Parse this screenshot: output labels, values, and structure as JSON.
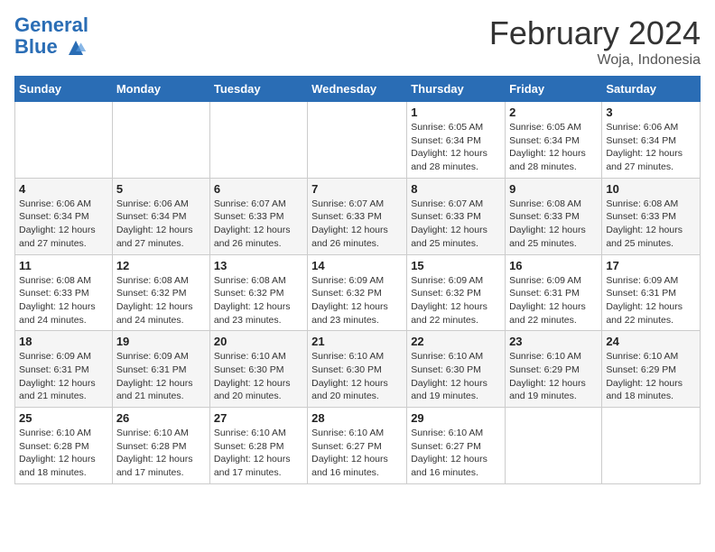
{
  "header": {
    "logo_general": "General",
    "logo_blue": "Blue",
    "month_title": "February 2024",
    "location": "Woja, Indonesia"
  },
  "days_of_week": [
    "Sunday",
    "Monday",
    "Tuesday",
    "Wednesday",
    "Thursday",
    "Friday",
    "Saturday"
  ],
  "weeks": [
    [
      {
        "num": "",
        "info": ""
      },
      {
        "num": "",
        "info": ""
      },
      {
        "num": "",
        "info": ""
      },
      {
        "num": "",
        "info": ""
      },
      {
        "num": "1",
        "info": "Sunrise: 6:05 AM\nSunset: 6:34 PM\nDaylight: 12 hours and 28 minutes."
      },
      {
        "num": "2",
        "info": "Sunrise: 6:05 AM\nSunset: 6:34 PM\nDaylight: 12 hours and 28 minutes."
      },
      {
        "num": "3",
        "info": "Sunrise: 6:06 AM\nSunset: 6:34 PM\nDaylight: 12 hours and 27 minutes."
      }
    ],
    [
      {
        "num": "4",
        "info": "Sunrise: 6:06 AM\nSunset: 6:34 PM\nDaylight: 12 hours and 27 minutes."
      },
      {
        "num": "5",
        "info": "Sunrise: 6:06 AM\nSunset: 6:34 PM\nDaylight: 12 hours and 27 minutes."
      },
      {
        "num": "6",
        "info": "Sunrise: 6:07 AM\nSunset: 6:33 PM\nDaylight: 12 hours and 26 minutes."
      },
      {
        "num": "7",
        "info": "Sunrise: 6:07 AM\nSunset: 6:33 PM\nDaylight: 12 hours and 26 minutes."
      },
      {
        "num": "8",
        "info": "Sunrise: 6:07 AM\nSunset: 6:33 PM\nDaylight: 12 hours and 25 minutes."
      },
      {
        "num": "9",
        "info": "Sunrise: 6:08 AM\nSunset: 6:33 PM\nDaylight: 12 hours and 25 minutes."
      },
      {
        "num": "10",
        "info": "Sunrise: 6:08 AM\nSunset: 6:33 PM\nDaylight: 12 hours and 25 minutes."
      }
    ],
    [
      {
        "num": "11",
        "info": "Sunrise: 6:08 AM\nSunset: 6:33 PM\nDaylight: 12 hours and 24 minutes."
      },
      {
        "num": "12",
        "info": "Sunrise: 6:08 AM\nSunset: 6:32 PM\nDaylight: 12 hours and 24 minutes."
      },
      {
        "num": "13",
        "info": "Sunrise: 6:08 AM\nSunset: 6:32 PM\nDaylight: 12 hours and 23 minutes."
      },
      {
        "num": "14",
        "info": "Sunrise: 6:09 AM\nSunset: 6:32 PM\nDaylight: 12 hours and 23 minutes."
      },
      {
        "num": "15",
        "info": "Sunrise: 6:09 AM\nSunset: 6:32 PM\nDaylight: 12 hours and 22 minutes."
      },
      {
        "num": "16",
        "info": "Sunrise: 6:09 AM\nSunset: 6:31 PM\nDaylight: 12 hours and 22 minutes."
      },
      {
        "num": "17",
        "info": "Sunrise: 6:09 AM\nSunset: 6:31 PM\nDaylight: 12 hours and 22 minutes."
      }
    ],
    [
      {
        "num": "18",
        "info": "Sunrise: 6:09 AM\nSunset: 6:31 PM\nDaylight: 12 hours and 21 minutes."
      },
      {
        "num": "19",
        "info": "Sunrise: 6:09 AM\nSunset: 6:31 PM\nDaylight: 12 hours and 21 minutes."
      },
      {
        "num": "20",
        "info": "Sunrise: 6:10 AM\nSunset: 6:30 PM\nDaylight: 12 hours and 20 minutes."
      },
      {
        "num": "21",
        "info": "Sunrise: 6:10 AM\nSunset: 6:30 PM\nDaylight: 12 hours and 20 minutes."
      },
      {
        "num": "22",
        "info": "Sunrise: 6:10 AM\nSunset: 6:30 PM\nDaylight: 12 hours and 19 minutes."
      },
      {
        "num": "23",
        "info": "Sunrise: 6:10 AM\nSunset: 6:29 PM\nDaylight: 12 hours and 19 minutes."
      },
      {
        "num": "24",
        "info": "Sunrise: 6:10 AM\nSunset: 6:29 PM\nDaylight: 12 hours and 18 minutes."
      }
    ],
    [
      {
        "num": "25",
        "info": "Sunrise: 6:10 AM\nSunset: 6:28 PM\nDaylight: 12 hours and 18 minutes."
      },
      {
        "num": "26",
        "info": "Sunrise: 6:10 AM\nSunset: 6:28 PM\nDaylight: 12 hours and 17 minutes."
      },
      {
        "num": "27",
        "info": "Sunrise: 6:10 AM\nSunset: 6:28 PM\nDaylight: 12 hours and 17 minutes."
      },
      {
        "num": "28",
        "info": "Sunrise: 6:10 AM\nSunset: 6:27 PM\nDaylight: 12 hours and 16 minutes."
      },
      {
        "num": "29",
        "info": "Sunrise: 6:10 AM\nSunset: 6:27 PM\nDaylight: 12 hours and 16 minutes."
      },
      {
        "num": "",
        "info": ""
      },
      {
        "num": "",
        "info": ""
      }
    ]
  ]
}
